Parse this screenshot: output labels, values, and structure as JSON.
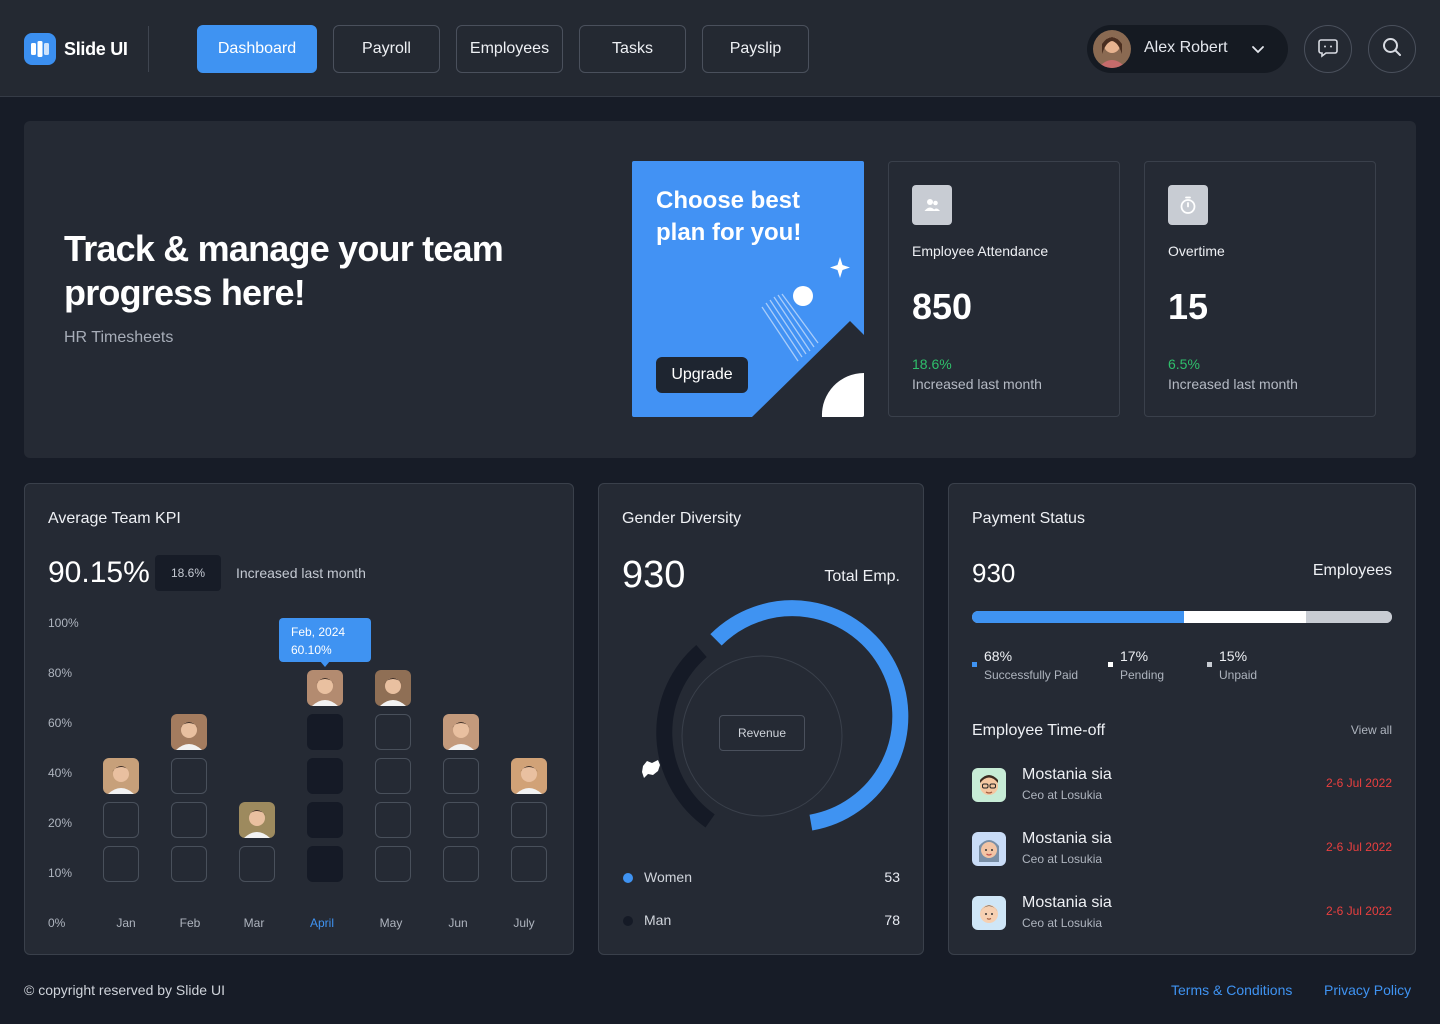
{
  "app": {
    "name": "Slide UI"
  },
  "nav": [
    {
      "label": "Dashboard",
      "active": true
    },
    {
      "label": "Payroll"
    },
    {
      "label": "Employees"
    },
    {
      "label": "Tasks"
    },
    {
      "label": "Payslip"
    }
  ],
  "user": {
    "name": "Alex Robert"
  },
  "icons": {
    "chat": "message-square-icon",
    "search": "search-icon",
    "chevron": "chevron-down-icon"
  },
  "hero": {
    "title": "Track & manage your team progress here!",
    "subtitle": "HR Timesheets"
  },
  "upgrade": {
    "title": "Choose best plan for you!",
    "button": "Upgrade"
  },
  "stats": [
    {
      "label": "Employee Attendance",
      "value": "850",
      "pct": "18.6%",
      "desc": "Increased last month",
      "icon": "users-icon"
    },
    {
      "label": "Overtime",
      "value": "15",
      "pct": "6.5%",
      "desc": "Increased last month",
      "icon": "stopwatch-icon"
    }
  ],
  "kpi": {
    "title": "Average Team KPI",
    "value": "90.15%",
    "badge": "18.6%",
    "badge_text": "Increased last month",
    "tooltip": {
      "date": "Feb, 2024",
      "value": "60.10%"
    },
    "y_ticks": [
      "100%",
      "80%",
      "60%",
      "40%",
      "20%",
      "10%",
      "0%"
    ]
  },
  "chart_data": {
    "type": "bar",
    "title": "Average Team KPI",
    "categories": [
      "Jan",
      "Feb",
      "Mar",
      "April",
      "May",
      "Jun",
      "July"
    ],
    "values": [
      40,
      60,
      20,
      80,
      80,
      60,
      40
    ],
    "highlighted": "April",
    "y_ticks": [
      "100%",
      "80%",
      "60%",
      "40%",
      "20%",
      "10%",
      "0%"
    ],
    "annotation": {
      "label": "Feb, 2024",
      "value": "60.10%"
    }
  },
  "gender": {
    "title": "Gender Diversity",
    "total": "930",
    "total_label": "Total Emp.",
    "center_label": "Revenue",
    "legend": [
      {
        "label": "Women",
        "value": "53",
        "color": "#3f93f2"
      },
      {
        "label": "Man",
        "value": "78",
        "color": "#151a26"
      }
    ]
  },
  "payment": {
    "title": "Payment Status",
    "total": "930",
    "total_label": "Employees",
    "segments": [
      {
        "pct": "68%",
        "label": "Successfully Paid",
        "fraction": 0.505,
        "color": "#3f93f2"
      },
      {
        "pct": "17%",
        "label": "Pending",
        "fraction": 0.29,
        "color": "#ffffff"
      },
      {
        "pct": "15%",
        "label": "Unpaid",
        "fraction": 0.205,
        "color": "#c8ccd3"
      }
    ]
  },
  "timeoff": {
    "title": "Employee Time-off",
    "view_all": "View all",
    "rows": [
      {
        "name": "Mostania sia",
        "role": "Ceo at Losukia",
        "date": "2-6 Jul 2022"
      },
      {
        "name": "Mostania sia",
        "role": "Ceo at Losukia",
        "date": "2-6 Jul 2022"
      },
      {
        "name": "Mostania sia",
        "role": "Ceo at Losukia",
        "date": "2-6 Jul 2022"
      }
    ]
  },
  "footer": {
    "copyright": "© copyright reserved by Slide UI",
    "terms": "Terms & Conditions",
    "privacy": "Privacy Policy"
  }
}
